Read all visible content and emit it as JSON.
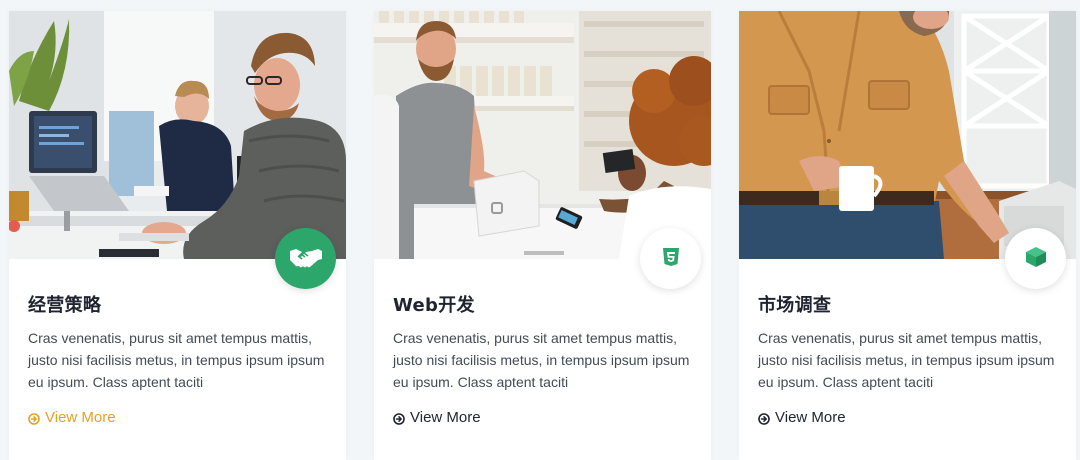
{
  "cards": [
    {
      "title": "经营策略",
      "description": "Cras venenatis, purus sit amet tempus mattis, justo nisi facilisis metus, in tempus ipsum ipsum eu ipsum. Class aptent taciti",
      "link_label": "View More",
      "icon": "handshake-icon",
      "badge_color": "#2ca66a",
      "link_color": "#e8a023",
      "image": "office-workers-at-computers-photo"
    },
    {
      "title": "Web开发",
      "description": "Cras venenatis, purus sit amet tempus mattis, justo nisi facilisis metus, in tempus ipsum ipsum eu ipsum. Class aptent taciti",
      "link_label": "View More",
      "icon": "html5-icon",
      "badge_color": "#ffffff",
      "link_color": "#1f2430",
      "image": "shop-payment-terminal-photo"
    },
    {
      "title": "市场调查",
      "description": "Cras venenatis, purus sit amet tempus mattis, justo nisi facilisis metus, in tempus ipsum ipsum eu ipsum. Class aptent taciti",
      "link_label": "View More",
      "icon": "cube-icon",
      "badge_color": "#ffffff",
      "link_color": "#1f2430",
      "image": "man-holding-coffee-mug-photo"
    }
  ],
  "colors": {
    "accent_green": "#2ca66a",
    "accent_orange": "#e8a023",
    "title": "#1f2430",
    "body_text": "#444a55",
    "page_background": "#f3f6f9"
  }
}
